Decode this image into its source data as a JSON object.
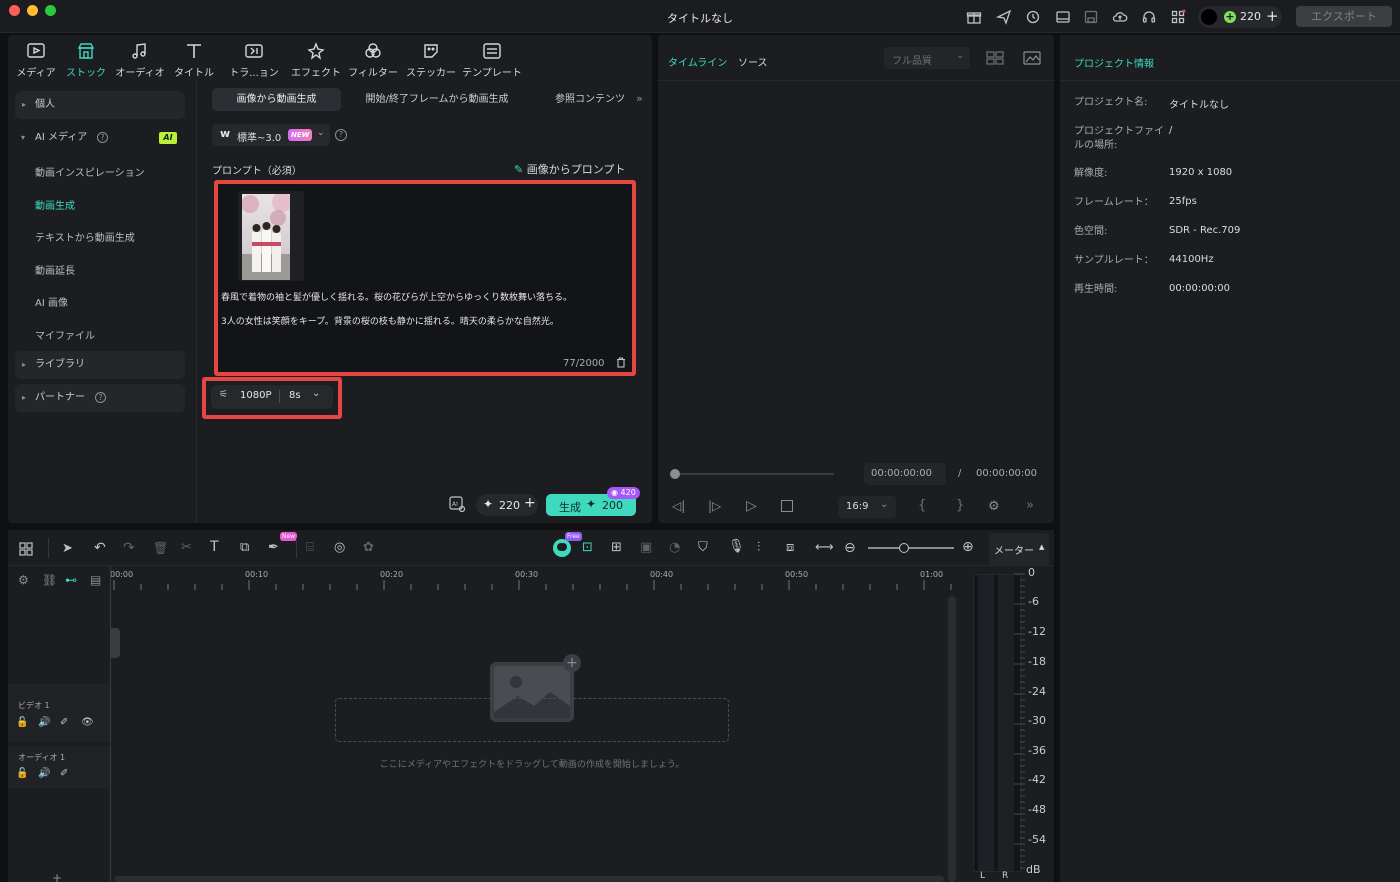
{
  "window": {
    "title": "タイトルなし"
  },
  "header": {
    "credits": "220",
    "export_label": "エクスポート"
  },
  "toolbar": {
    "items": [
      {
        "label": "メディア"
      },
      {
        "label": "ストック"
      },
      {
        "label": "オーディオ"
      },
      {
        "label": "タイトル"
      },
      {
        "label": "トラ...ョン"
      },
      {
        "label": "エフェクト"
      },
      {
        "label": "フィルター"
      },
      {
        "label": "ステッカー"
      },
      {
        "label": "テンプレート"
      }
    ],
    "active_index": 1
  },
  "sidebar": {
    "personal": "個人",
    "ai_media": "AI メディア",
    "ai_badge": "AI",
    "sub_items": [
      "動画インスピレーション",
      "動画生成",
      "テキストから動画生成",
      "動画延長",
      "AI 画像",
      "マイファイル"
    ],
    "active_sub": 1,
    "library": "ライブラリ",
    "partner": "パートナー"
  },
  "gen_tabs": [
    "画像から動画生成",
    "開始/終了フレームから動画生成",
    "参照コンテンツ"
  ],
  "model": {
    "name": "標準~3.0",
    "badge": "NEW"
  },
  "prompt": {
    "label": "プロンプト（必須）",
    "image_to_prompt": "画像からプロンプト",
    "line1": "春風で着物の袖と髪が優しく揺れる。桜の花びらが上空からゆっくり数枚舞い落ちる。",
    "line2": "3人の女性は笑顔をキープ。背景の桜の枝も静かに揺れる。晴天の柔らかな自然光。",
    "counter": "77/2000"
  },
  "settings": {
    "resolution": "1080P",
    "duration": "8s"
  },
  "generate": {
    "credits": "220",
    "label": "生成",
    "cost": "200",
    "badge": "420"
  },
  "preview": {
    "tab_timeline": "タイムライン",
    "tab_source": "ソース",
    "quality": "フル品質",
    "time_current": "00:00:00:00",
    "time_sep": "/",
    "time_total": "00:00:00:00",
    "ratio": "16:9"
  },
  "project_info": {
    "title": "プロジェクト情報",
    "rows": [
      {
        "key": "プロジェクト名:",
        "value": "タイトルなし"
      },
      {
        "key": "プロジェクトファイルの場所:",
        "value": "/"
      },
      {
        "key": "解像度:",
        "value": "1920 x 1080"
      },
      {
        "key": "フレームレート：",
        "value": "25fps"
      },
      {
        "key": "色空間:",
        "value": "SDR - Rec.709"
      },
      {
        "key": "サンプルレート：",
        "value": "44100Hz"
      },
      {
        "key": "再生時間:",
        "value": "00:00:00:00"
      }
    ]
  },
  "timeline": {
    "meter_label": "メーター",
    "new_badge": "New",
    "free_badge": "Free",
    "ruler": [
      "00:00",
      "00:10",
      "00:20",
      "00:30",
      "00:40",
      "00:50",
      "01:00"
    ],
    "tracks": [
      {
        "label": "ビデオ 1"
      },
      {
        "label": "オーディオ 1"
      }
    ],
    "drop_hint": "ここにメディアやエフェクトをドラッグして動画の作成を開始しましょう。",
    "db_scale": [
      "0",
      "-6",
      "-12",
      "-18",
      "-24",
      "-30",
      "-36",
      "-42",
      "-48",
      "-54",
      "dB"
    ],
    "channels": [
      "L",
      "R"
    ]
  },
  "colors": {
    "accent": "#3fd9be",
    "highlight_border": "#e5463f",
    "panel": "#1c1d21"
  }
}
